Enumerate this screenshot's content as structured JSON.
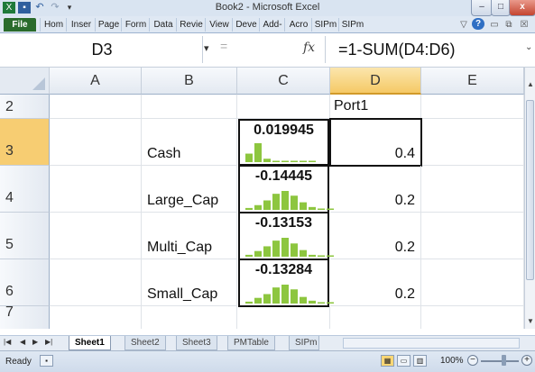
{
  "window": {
    "title": "Book2 - Microsoft Excel",
    "minimize": "–",
    "maximize": "□",
    "close": "x"
  },
  "quick_access": {
    "app_icon": "excel-icon",
    "save_icon": "save-icon",
    "undo_icon": "undo-icon",
    "redo_icon": "redo-icon",
    "customize_icon": "customize-icon"
  },
  "ribbon_tabs": [
    "File",
    "Hom",
    "Inser",
    "Page",
    "Form",
    "Data",
    "Revie",
    "View",
    "Deve",
    "Add-",
    "Acro",
    "SIPm",
    "SIPm"
  ],
  "ribbon_right": {
    "minimize_ribbon": "▽",
    "help": "?",
    "win_min": "▭",
    "win_restore": "⧉",
    "win_close": "☒"
  },
  "formula_bar": {
    "name_box": "D3",
    "dropdown": "▾",
    "cancel": "=",
    "fx": "fx",
    "formula": "=1-SUM(D4:D6)",
    "expand": "⌄"
  },
  "columns": [
    "A",
    "B",
    "C",
    "D",
    "E"
  ],
  "rows": [
    {
      "num": "2",
      "b": "",
      "c_value": null,
      "d": "Port1"
    },
    {
      "num": "3",
      "b": "Cash",
      "c_value": "0.019945",
      "d": "0.4",
      "spark": [
        0.45,
        1.0,
        0.18,
        0,
        0.05,
        0.05,
        0,
        0.03
      ]
    },
    {
      "num": "4",
      "b": "Large_Cap",
      "c_value": "-0.14445",
      "d": "0.2",
      "spark": [
        0.1,
        0.25,
        0.5,
        0.85,
        1.0,
        0.75,
        0.4,
        0.15,
        0.05,
        0.03
      ]
    },
    {
      "num": "5",
      "b": "Multi_Cap",
      "c_value": "-0.13153",
      "d": "0.2",
      "spark": [
        0.1,
        0.3,
        0.55,
        0.85,
        1.0,
        0.7,
        0.35,
        0.1,
        0.05,
        0.03
      ]
    },
    {
      "num": "6",
      "b": "Small_Cap",
      "c_value": "-0.13284",
      "d": "0.2",
      "spark": [
        0.1,
        0.3,
        0.5,
        0.85,
        1.0,
        0.75,
        0.35,
        0.15,
        0.05,
        0.03
      ]
    },
    {
      "num": "7",
      "b": "",
      "c_value": null,
      "d": ""
    }
  ],
  "sheet_tabs": [
    "Sheet1",
    "Sheet2",
    "Sheet3",
    "PMTable",
    "SIPm"
  ],
  "sheet_nav": [
    "|◀",
    "◀",
    "▶",
    "▶|"
  ],
  "status": {
    "ready": "Ready",
    "zoom": "100%",
    "zoom_out": "−",
    "zoom_in": "+"
  },
  "colors": {
    "spark_bar": "#8dc63f",
    "selected_header": "#f5c966",
    "file_tab": "#2a6b2c",
    "title_bar": "#d9e4f1"
  }
}
